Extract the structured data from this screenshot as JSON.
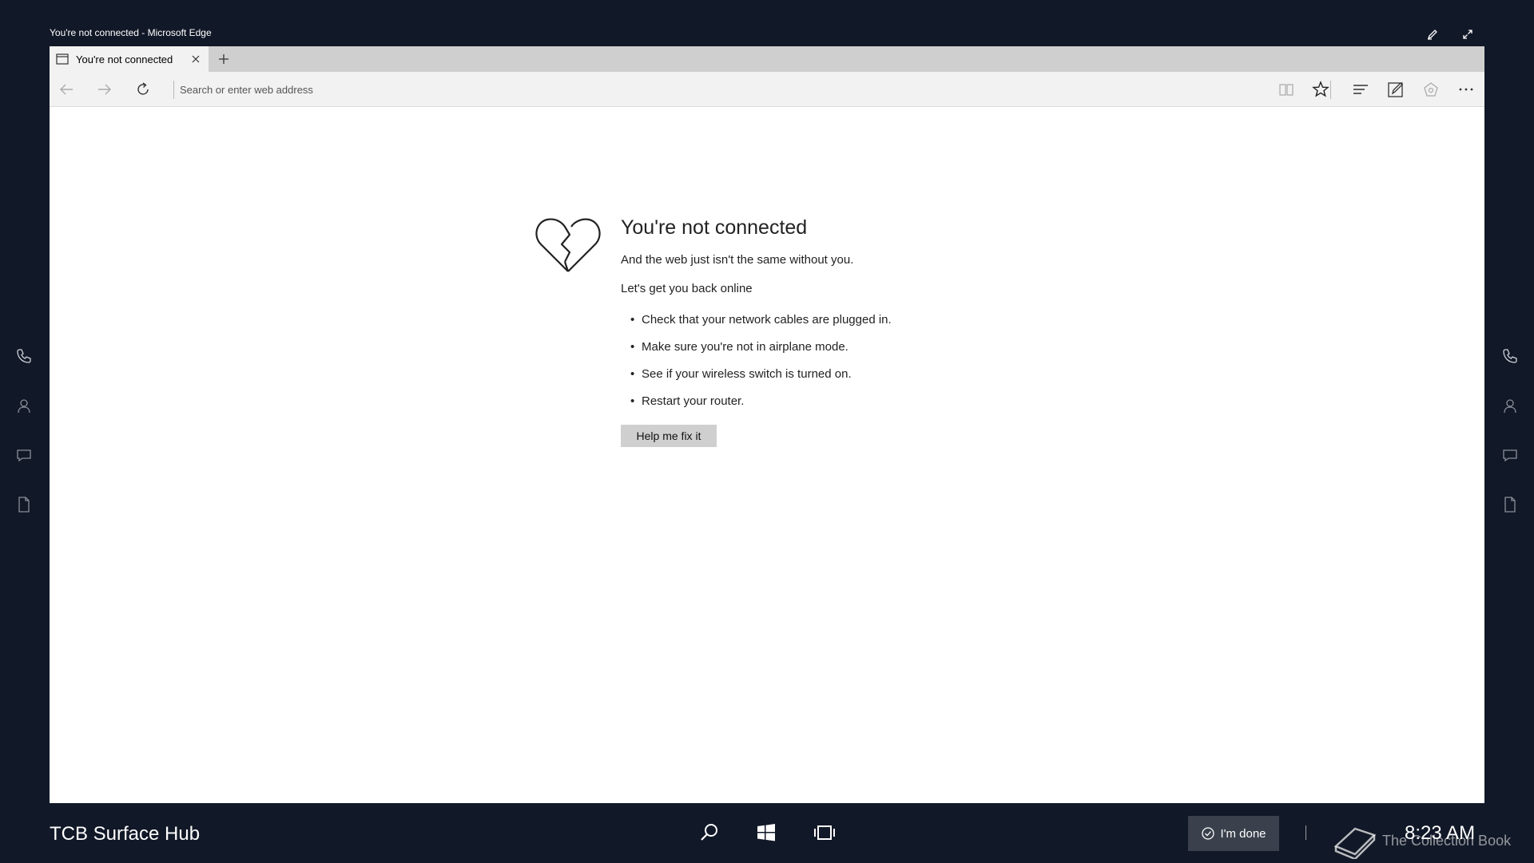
{
  "window": {
    "title": "You're not connected - Microsoft Edge"
  },
  "tabs": [
    {
      "label": "You're not connected",
      "icon": "page-icon",
      "active": true
    }
  ],
  "address_bar": {
    "placeholder": "Search or enter web address",
    "value": ""
  },
  "toolbar": {
    "icons": [
      "back-icon",
      "forward-icon",
      "refresh-icon",
      "reading-view-icon",
      "favorites-star-icon",
      "hub-icon",
      "web-note-icon",
      "share-icon",
      "more-icon"
    ]
  },
  "error_page": {
    "title": "You're not connected",
    "subtitle": "And the web just isn't the same without you.",
    "online_heading": "Let's get you back online",
    "tips": [
      "Check that your network cables are plugged in.",
      "Make sure you're not in airplane mode.",
      "See if your wireless switch is turned on.",
      "Restart your router."
    ],
    "fix_button": "Help me fix it"
  },
  "side_rails": {
    "icons": [
      "phone-icon",
      "person-icon",
      "chat-icon",
      "document-icon"
    ]
  },
  "taskbar": {
    "device_name": "TCB Surface Hub",
    "done_button": "I'm done",
    "clock": "8:23 AM",
    "watermark": "The Collection Book"
  },
  "colors": {
    "background": "#111827",
    "tab_strip": "#cfcfcf",
    "toolbar": "#f2f2f2",
    "button": "#cfcfcf",
    "done_button": "#3a414c"
  }
}
